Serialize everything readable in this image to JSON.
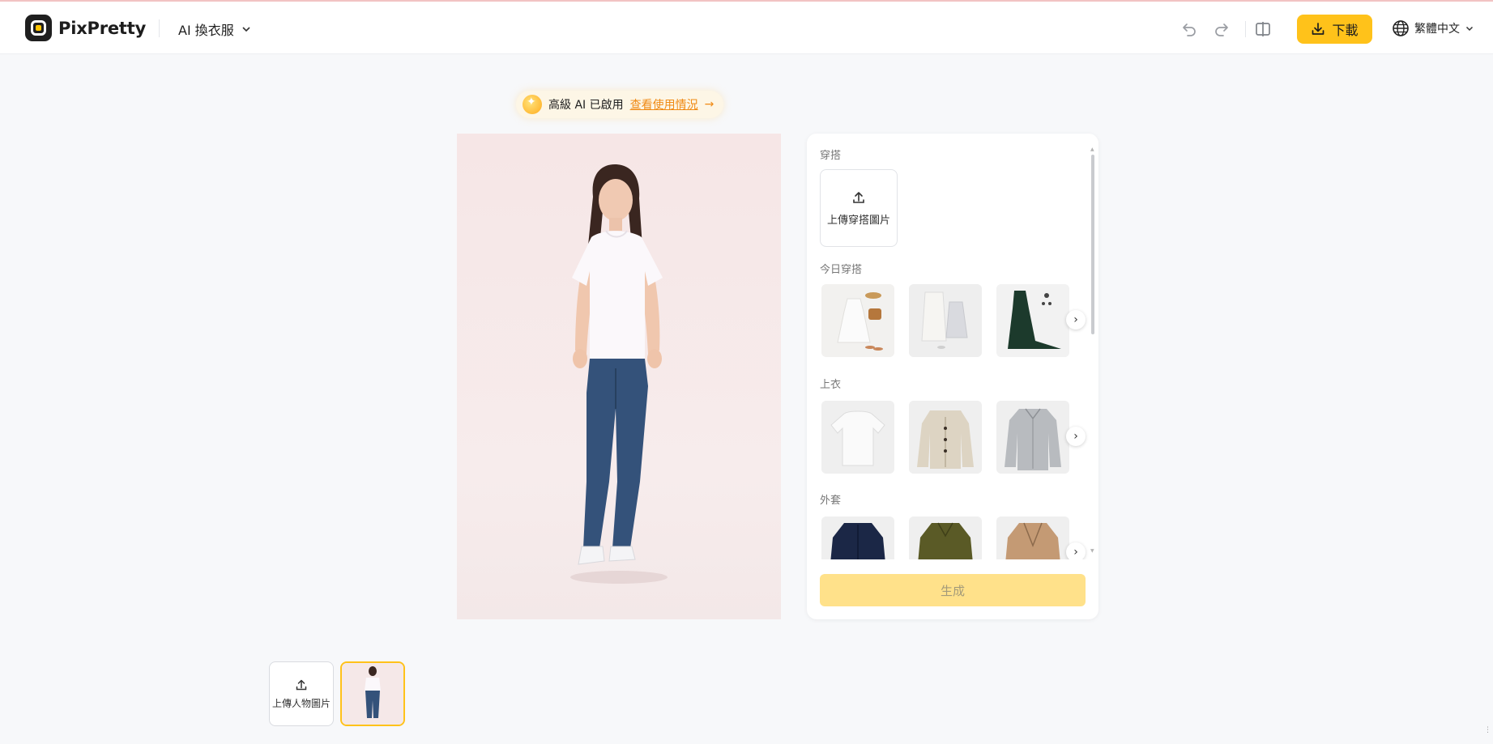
{
  "header": {
    "brand": "PixPretty",
    "tool_select": "AI 換衣服",
    "download_label": "下載",
    "language": "繁體中文"
  },
  "banner": {
    "text": "高級 AI 已啟用",
    "link": "查看使用情況",
    "arrow": "→"
  },
  "panel": {
    "outfit_section": "穿搭",
    "upload_outfit_label": "上傳穿搭圖片",
    "sections": [
      {
        "title": "今日穿搭",
        "items": [
          "white-dress-outfit",
          "white-coat-outfit",
          "green-gown-outfit"
        ]
      },
      {
        "title": "上衣",
        "items": [
          "white-tshirt",
          "beige-cardigan",
          "grey-shirt"
        ]
      },
      {
        "title": "外套",
        "items": [
          "navy-jacket",
          "olive-jacket",
          "camel-blazer"
        ]
      }
    ],
    "generate_label": "生成"
  },
  "bottom": {
    "upload_person_label": "上傳人物圖片"
  },
  "colors": {
    "accent": "#ffc21a",
    "link": "#f08a14",
    "generate_disabled": "#ffe18a"
  }
}
